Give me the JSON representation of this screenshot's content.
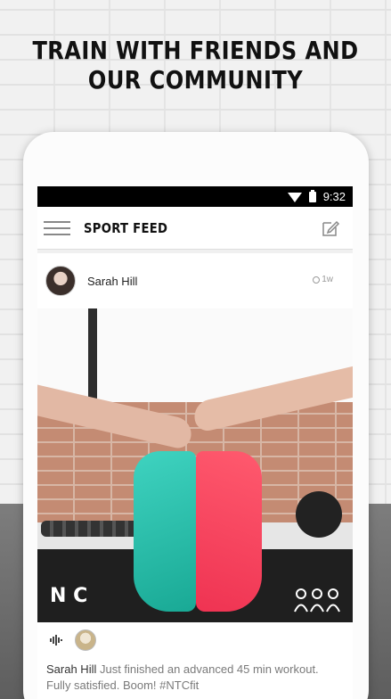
{
  "headline": {
    "line1": "TRAIN WITH FRIENDS AND",
    "line2": "OUR COMMUNITY"
  },
  "status_bar": {
    "time": "9:32"
  },
  "app_bar": {
    "title": "SPORT FEED",
    "menu_icon": "hamburger-icon",
    "compose_icon": "compose-icon"
  },
  "post": {
    "author": "Sarah Hill",
    "time_ago": "1w",
    "photo_logo": "N C",
    "caption_author": "Sarah Hill",
    "caption_text": " Just finished an advanced 45 min workout. Fully satisfied. Boom! #NTCfit"
  },
  "colors": {
    "headline": "#111111",
    "status_bar": "#000000",
    "teal_shoe": "#2ac2ae",
    "pink_shoe": "#f7425c"
  }
}
